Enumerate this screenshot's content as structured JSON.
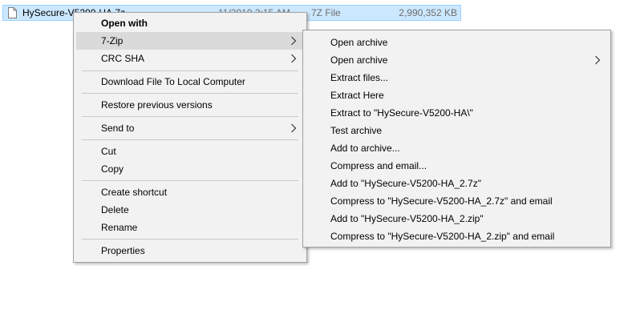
{
  "file": {
    "name": "HySecure-V5200-HA.7z",
    "date": "11/2019 3:15 AM",
    "type": "7Z File",
    "size": "2,990,352 KB"
  },
  "context_menu": {
    "items": [
      {
        "label": "Open with",
        "bold": true
      },
      {
        "label": "7-Zip",
        "has_submenu": true,
        "highlighted": true
      },
      {
        "label": "CRC SHA",
        "has_submenu": true
      },
      {
        "label": "Download File To Local Computer"
      },
      {
        "label": "Restore previous versions"
      },
      {
        "label": "Send to",
        "has_submenu": true
      },
      {
        "label": "Cut"
      },
      {
        "label": "Copy"
      },
      {
        "label": "Create shortcut"
      },
      {
        "label": "Delete"
      },
      {
        "label": "Rename"
      },
      {
        "label": "Properties"
      }
    ]
  },
  "zip_submenu": {
    "items": [
      {
        "label": "Open archive"
      },
      {
        "label": "Open archive",
        "has_submenu": true
      },
      {
        "label": "Extract files..."
      },
      {
        "label": "Extract Here"
      },
      {
        "label": "Extract to \"HySecure-V5200-HA\\\""
      },
      {
        "label": "Test archive"
      },
      {
        "label": "Add to archive..."
      },
      {
        "label": "Compress and email..."
      },
      {
        "label": "Add to \"HySecure-V5200-HA_2.7z\""
      },
      {
        "label": "Compress to \"HySecure-V5200-HA_2.7z\" and email"
      },
      {
        "label": "Add to \"HySecure-V5200-HA_2.zip\""
      },
      {
        "label": "Compress to \"HySecure-V5200-HA_2.zip\" and email"
      }
    ]
  },
  "colors": {
    "selection_bg": "#cce8ff",
    "selection_border": "#99d1ff",
    "menu_bg": "#f2f2f2",
    "menu_highlight": "#dadada",
    "menu_border": "#a0a0a0"
  },
  "icons": {
    "file_icon": "document-icon",
    "submenu_arrow": "chevron-right-icon"
  }
}
